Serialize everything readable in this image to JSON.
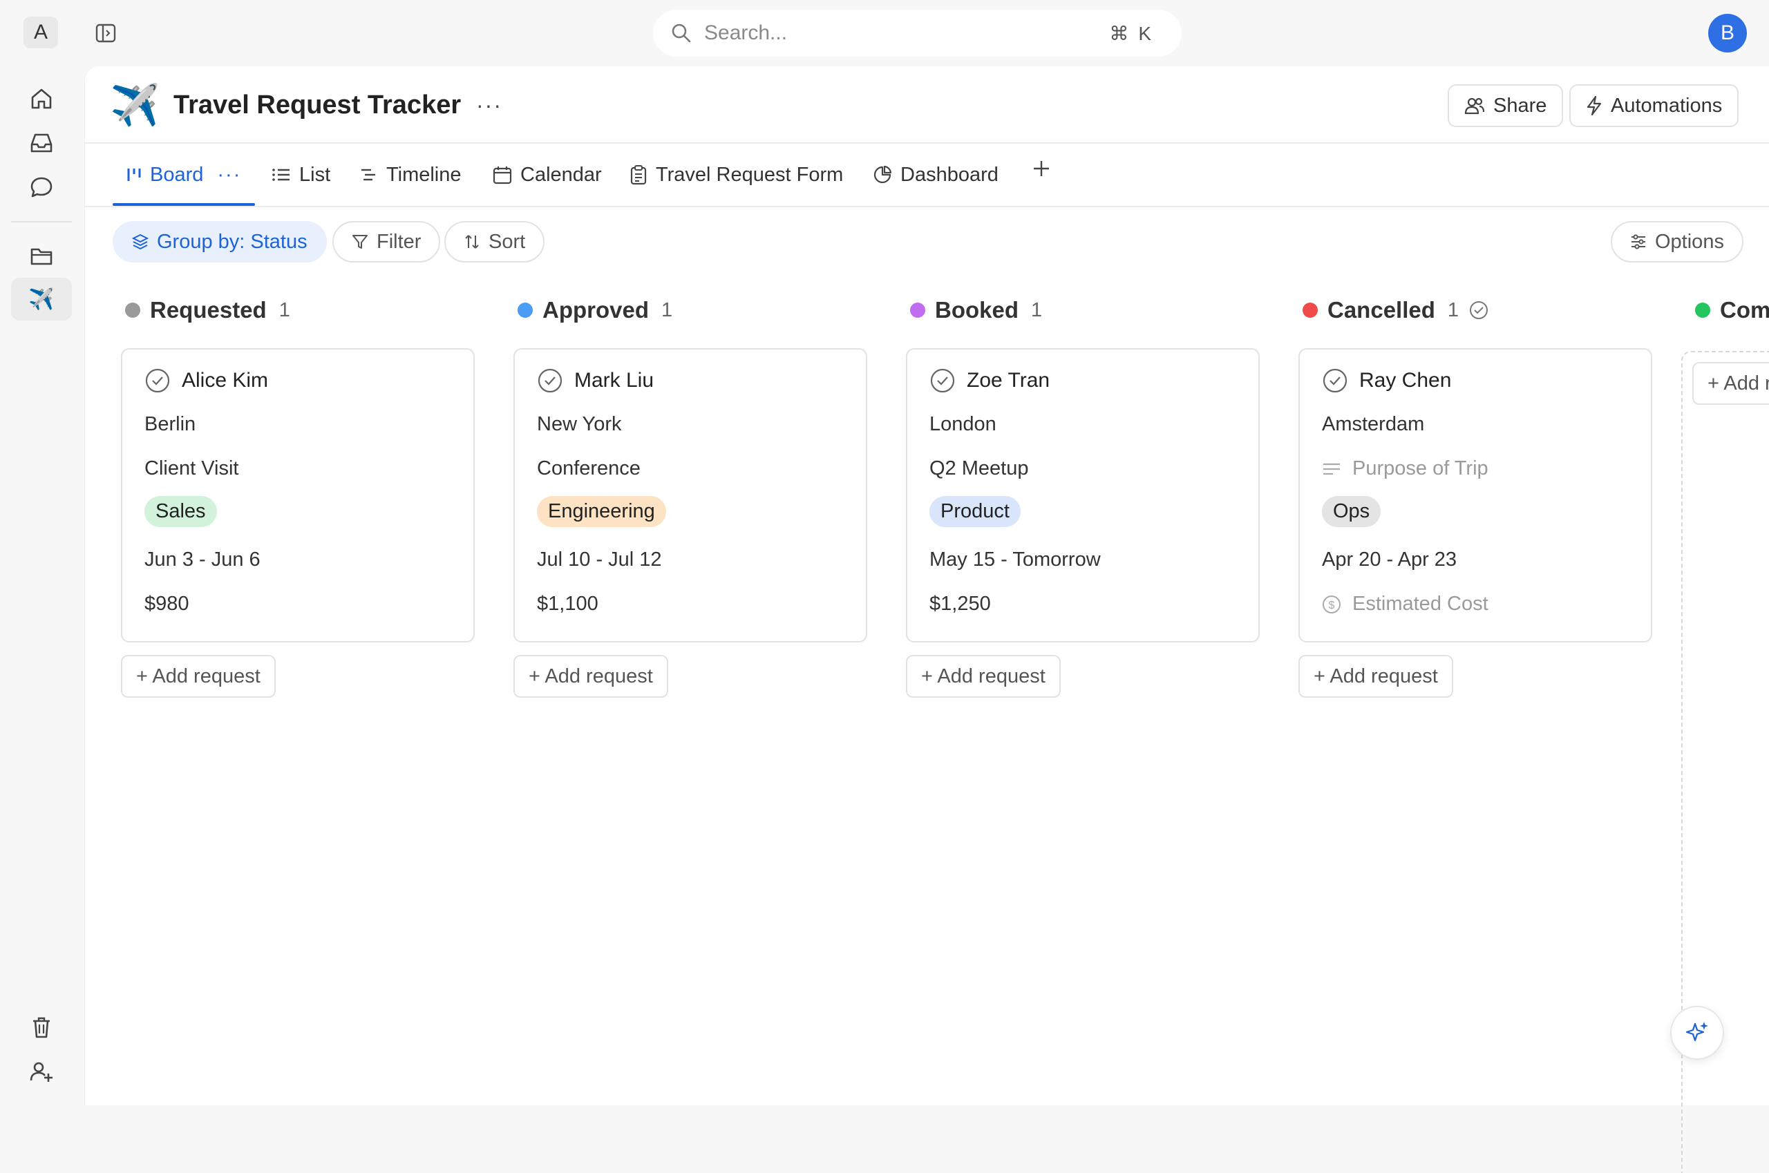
{
  "workspace": {
    "badge": "A"
  },
  "search": {
    "placeholder": "Search...",
    "shortcut_cmd": "⌘",
    "shortcut_key": "K"
  },
  "user": {
    "avatar_letter": "B"
  },
  "page": {
    "emoji": "✈️",
    "title": "Travel Request Tracker",
    "more": "···"
  },
  "header_actions": {
    "share": "Share",
    "automations": "Automations"
  },
  "tabs": [
    {
      "label": "Board",
      "active": true,
      "more": "···"
    },
    {
      "label": "List"
    },
    {
      "label": "Timeline"
    },
    {
      "label": "Calendar"
    },
    {
      "label": "Travel Request Form"
    },
    {
      "label": "Dashboard"
    }
  ],
  "toolbar": {
    "group_by": "Group by: Status",
    "filter": "Filter",
    "sort": "Sort",
    "options": "Options"
  },
  "columns": [
    {
      "title": "Requested",
      "count": "1",
      "color": "#9a9a9a",
      "card": {
        "name": "Alice Kim",
        "destination": "Berlin",
        "purpose": "Client Visit",
        "department": "Sales",
        "dept_bg": "#d3f2dc",
        "dates": "Jun 3 - Jun 6",
        "cost": "$980"
      },
      "add_label": "+ Add request"
    },
    {
      "title": "Approved",
      "count": "1",
      "color": "#4a9cf5",
      "card": {
        "name": "Mark Liu",
        "destination": "New York",
        "purpose": "Conference",
        "department": "Engineering",
        "dept_bg": "#fde2c4",
        "dates": "Jul 10 - Jul 12",
        "cost": "$1,100"
      },
      "add_label": "+ Add request"
    },
    {
      "title": "Booked",
      "count": "1",
      "color": "#c06cf0",
      "card": {
        "name": "Zoe Tran",
        "destination": "London",
        "purpose": "Q2 Meetup",
        "department": "Product",
        "dept_bg": "#d9e5fb",
        "dates": "May 15 - Tomorrow",
        "cost": "$1,250"
      },
      "add_label": "+ Add request"
    },
    {
      "title": "Cancelled",
      "count": "1",
      "color": "#ef4b4b",
      "card": {
        "name": "Ray Chen",
        "destination": "Amsterdam",
        "purpose_placeholder": "Purpose of Trip",
        "department": "Ops",
        "dept_bg": "#e4e4e4",
        "dates": "Apr 20 - Apr 23",
        "cost_placeholder": "Estimated Cost"
      },
      "add_label": "+ Add request"
    },
    {
      "title": "Com",
      "color": "#22c55e",
      "add_label": "+ Add r"
    }
  ]
}
